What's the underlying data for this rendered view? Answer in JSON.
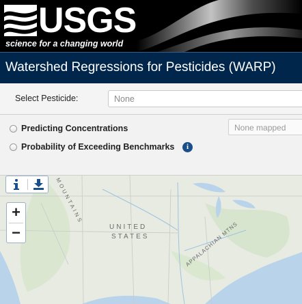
{
  "banner": {
    "logo_text": "USGS",
    "tagline": "science for a changing world"
  },
  "title": "Watershed Regressions for Pesticides (WARP)",
  "controls": {
    "select_label": "Select Pesticide:",
    "select_value": "None",
    "options": [
      {
        "label": "Predicting Concentrations",
        "selected": false
      },
      {
        "label": "Probability of Exceeding Benchmarks",
        "selected": false,
        "has_info": true
      }
    ],
    "mapped_status": "None mapped"
  },
  "map": {
    "labels": {
      "mountains": "MOUNTAINS",
      "united": "UNITED",
      "states": "STATES",
      "appalachian": "APPALACHIAN MTNS"
    },
    "toolbar": {
      "info_icon": "info-icon",
      "download_icon": "download-icon"
    },
    "zoom_in": "+",
    "zoom_out": "−"
  },
  "colors": {
    "title_bar": "#00264c",
    "banner": "#000000",
    "info_icon": "#1b4f8a",
    "map_land": "#e9ece4",
    "map_water": "#b9d4ea"
  }
}
